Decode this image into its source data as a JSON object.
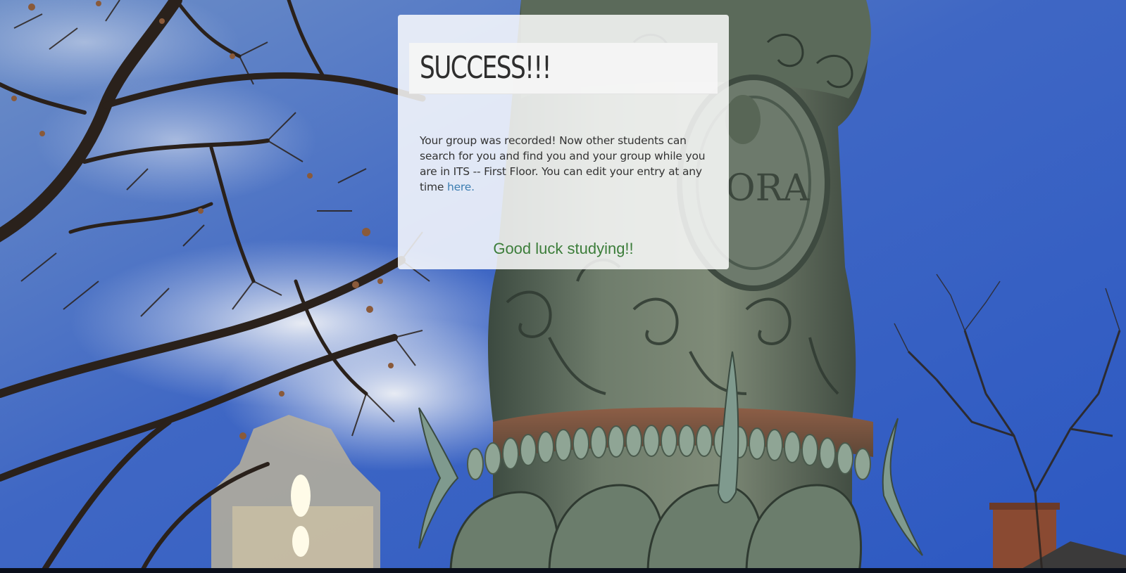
{
  "card": {
    "title": "SUCCESS!!!",
    "message_before": "Your group was recorded! Now other students can search for you and find you and your group while you are in ITS -- First Floor. You can edit your entry at any time ",
    "edit_link_label": "here.",
    "good_luck": "Good luck studying!!"
  },
  "colors": {
    "link": "#3b7db1",
    "good_luck": "#3c7d3a",
    "title": "#2e2e2e",
    "body_text": "#333333"
  },
  "background": {
    "description_icon": "campus-photo"
  }
}
